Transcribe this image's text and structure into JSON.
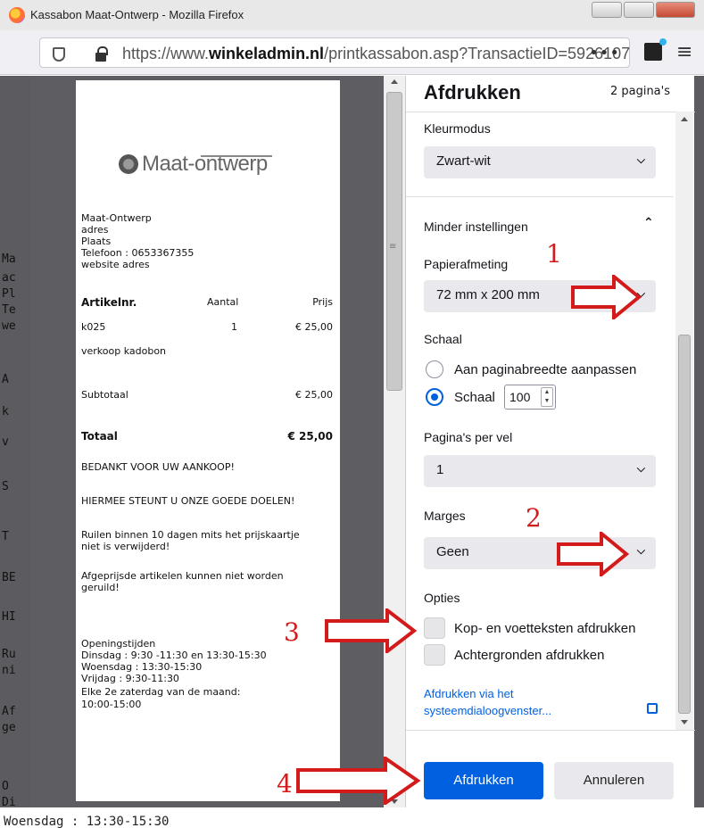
{
  "window": {
    "title": "Kassabon Maat-Ontwerp - Mozilla Firefox",
    "url_prefix": "https://www.",
    "url_domain": "winkeladmin.nl",
    "url_path": "/printkassabon.asp?TransactieID=5926107",
    "url_more": "•••"
  },
  "background_page": {
    "lines": [
      "Ma",
      "ac",
      "Pl",
      "Te",
      "we",
      "A",
      "k",
      "v",
      "S",
      "T",
      "BE",
      "HI",
      "Ru",
      "ni",
      "Af",
      "ge",
      "O",
      "Di"
    ],
    "bottom_text": "Woensdag : 13:30-15:30"
  },
  "receipt": {
    "logo_text": "Maat-ontwerp",
    "address_lines": [
      "Maat-Ontwerp",
      "adres",
      "Plaats",
      "Telefoon : 0653367355",
      "website adres"
    ],
    "table_headers": {
      "article": "Artikelnr.",
      "qty": "Aantal",
      "price": "Prijs"
    },
    "items": [
      {
        "article": "k025",
        "qty": "1",
        "price": "€ 25,00",
        "desc": "verkoop kadobon"
      }
    ],
    "subtotal_label": "Subtotaal",
    "subtotal_value": "€ 25,00",
    "total_label": "Totaal",
    "total_value": "€ 25,00",
    "thanks": "BEDANKT VOOR UW AANKOOP!",
    "charity": "HIERMEE STEUNT U ONZE GOEDE DOELEN!",
    "return_1": "Ruilen binnen 10 dagen mits het prijskaartje",
    "return_2": "niet is verwijderd!",
    "discount_1": "Afgeprijsde artikelen kunnen niet worden",
    "discount_2": "geruild!",
    "hours_title": "Openingstijden",
    "hours": [
      "Dinsdag : 9:30 -11:30 en 13:30-15:30",
      "Woensdag : 13:30-15:30",
      "Vrijdag : 9:30-11:30",
      "Elke 2e zaterdag van de maand:",
      "10:00-15:00"
    ]
  },
  "panel": {
    "title": "Afdrukken",
    "pages": "2 pagina's",
    "color_mode_label": "Kleurmodus",
    "color_mode_value": "Zwart-wit",
    "less_settings": "Minder instellingen",
    "paper_size_label": "Papierafmeting",
    "paper_size_value": "72 mm x 200 mm",
    "scale_label": "Schaal",
    "scale_fit": "Aan paginabreedte aanpassen",
    "scale_custom": "Schaal",
    "scale_value": "100",
    "pages_per_sheet_label": "Pagina's per vel",
    "pages_per_sheet_value": "1",
    "margins_label": "Marges",
    "margins_value": "Geen",
    "options_label": "Opties",
    "opt_headers": "Kop- en voetteksten afdrukken",
    "opt_backgrounds": "Achtergronden afdrukken",
    "system_dialog_1": "Afdrukken via het",
    "system_dialog_2": "systeemdialoogvenster...",
    "print_button": "Afdrukken",
    "cancel_button": "Annuleren"
  },
  "annotations": {
    "n1": "1",
    "n2": "2",
    "n3": "3",
    "n4": "4",
    "color": "#d31b1b"
  }
}
